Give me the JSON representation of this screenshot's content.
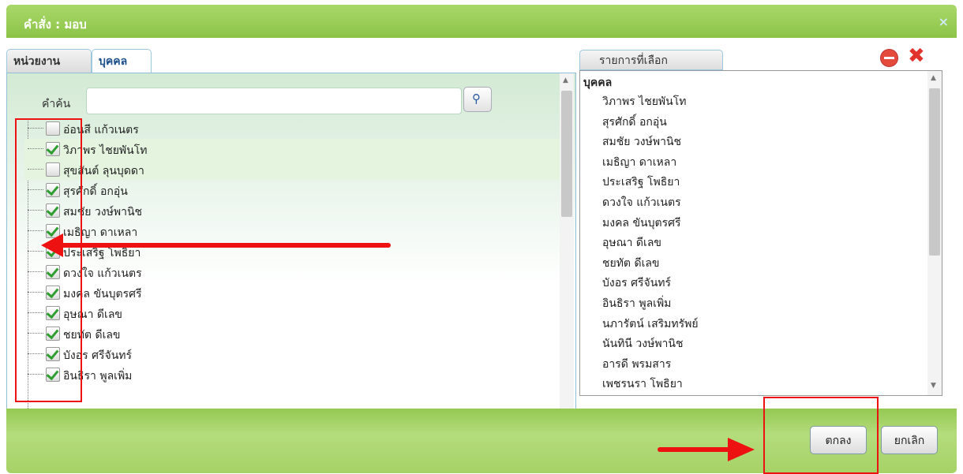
{
  "dialog": {
    "title": "คำสั่ง : มอบ",
    "close_label": "×"
  },
  "tabs": [
    {
      "label": "หน่วยงาน",
      "active": false
    },
    {
      "label": "บุคคล",
      "active": true
    }
  ],
  "search": {
    "label": "คำค้น",
    "value": "",
    "button_icon": "search-icon"
  },
  "tree_items": [
    {
      "label": "อ่อนสี แก้วเนตร",
      "checked": false
    },
    {
      "label": "วิภาพร ไชยพันโท",
      "checked": true
    },
    {
      "label": "สุขสันต์ ลุนบุดดา",
      "checked": false
    },
    {
      "label": "สุรศักดิ์ อกอุ่น",
      "checked": true
    },
    {
      "label": "สมชัย วงษ์พานิช",
      "checked": true
    },
    {
      "label": "เมธิญา ดาเหลา",
      "checked": true
    },
    {
      "label": "ประเสริฐ โพธิยา",
      "checked": true
    },
    {
      "label": "ดวงใจ แก้วเนตร",
      "checked": true
    },
    {
      "label": "มงคล ขันบุตรศรี",
      "checked": true
    },
    {
      "label": "อุษณา ดีเลข",
      "checked": true
    },
    {
      "label": "ชยทัต ดีเลข",
      "checked": true
    },
    {
      "label": "บังอร ศรีจันทร์",
      "checked": true
    },
    {
      "label": "อินธิรา พูลเพิ่ม",
      "checked": true
    }
  ],
  "selected_panel": {
    "tab_label": "รายการที่เลือก",
    "group_header": "บุคคล",
    "items": [
      "วิภาพร ไชยพันโท",
      "สุรศักดิ์ อกอุ่น",
      "สมชัย วงษ์พานิช",
      "เมธิญา ดาเหลา",
      "ประเสริฐ โพธิยา",
      "ดวงใจ แก้วเนตร",
      "มงคล ขันบุตรศรี",
      "อุษณา ดีเลข",
      "ชยทัต ดีเลข",
      "บังอร ศรีจันทร์",
      "อินธิรา พูลเพิ่ม",
      "นภารัตน์ เสริมทรัพย์",
      "นันทินี วงษ์พานิช",
      "อารดี พรมสาร",
      "เพชรนรา โพธิยา"
    ]
  },
  "footer": {
    "ok_label": "ตกลง",
    "cancel_label": "ยกเลิก"
  },
  "colors": {
    "header_green": "#8cc447",
    "highlight_red": "#e11111",
    "check_green": "#2f9d2f"
  }
}
